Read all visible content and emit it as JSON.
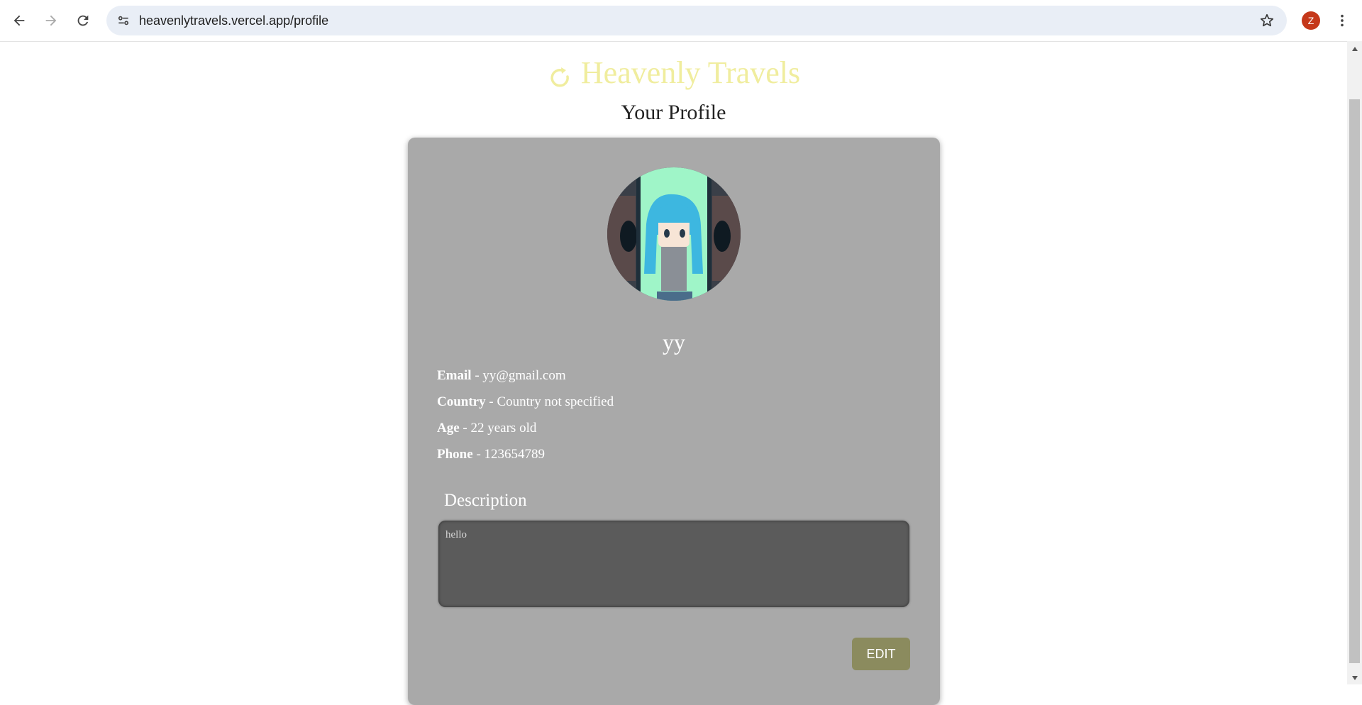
{
  "browser": {
    "url": "heavenlytravels.vercel.app/profile",
    "profile_initial": "Z"
  },
  "header": {
    "brand": "Heavenly Travels",
    "brand_color": "#f0ed9e",
    "page_title": "Your Profile"
  },
  "profile": {
    "username": "yy",
    "fields": [
      {
        "label": "Email",
        "value": "- yy@gmail.com"
      },
      {
        "label": "Country",
        "value": "- Country not specified"
      },
      {
        "label": "Age",
        "value": "- 22 years old"
      },
      {
        "label": "Phone",
        "value": "- 123654789"
      }
    ],
    "description_label": "Description",
    "description": "hello",
    "edit_label": "EDIT"
  },
  "icons": {
    "back": "arrow-left-icon",
    "forward": "arrow-right-icon",
    "reload": "reload-icon",
    "site_info": "tune-icon",
    "bookmark": "star-icon",
    "menu": "kebab-menu-icon",
    "brand": "refresh-circle-icon"
  }
}
